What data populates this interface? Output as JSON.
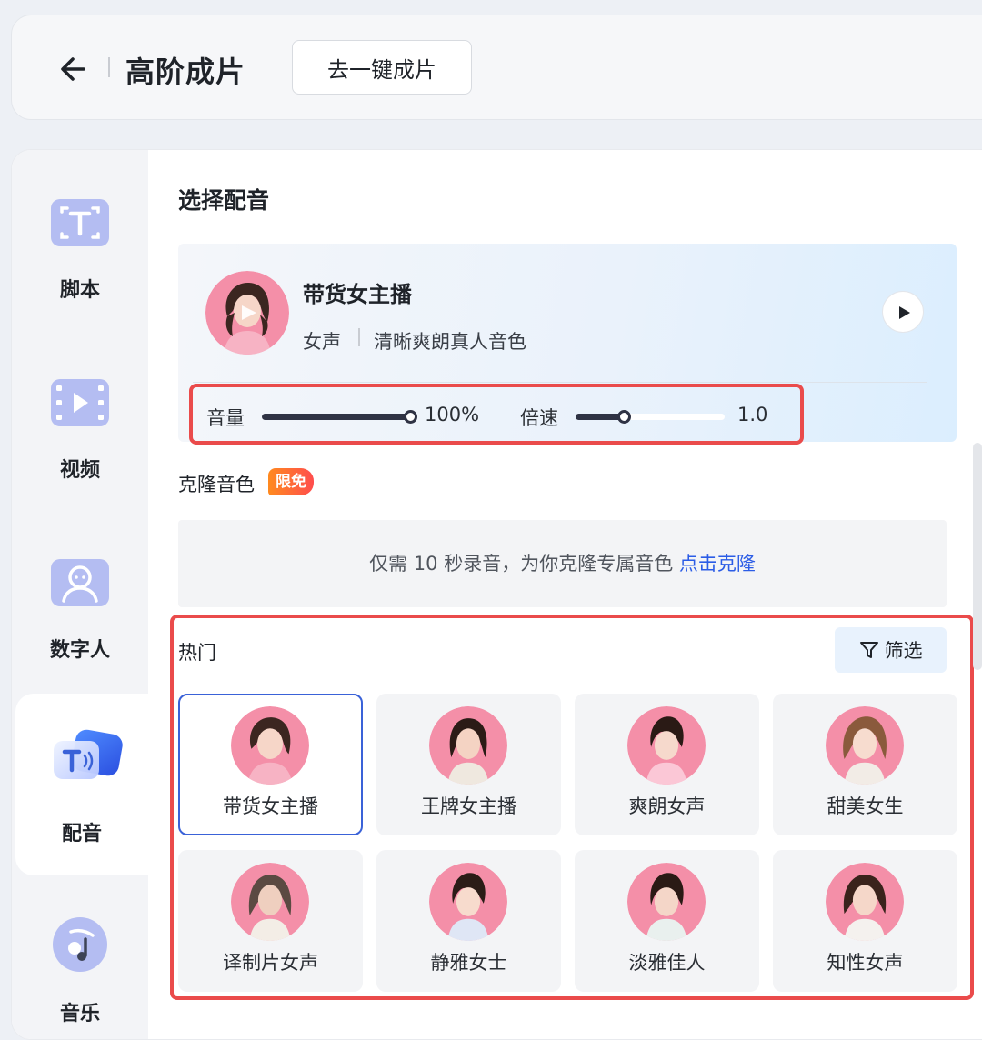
{
  "header": {
    "title": "高阶成片",
    "oneclick_label": "去一键成片"
  },
  "sidebar": {
    "items": [
      {
        "label": "脚本",
        "icon": "script-icon"
      },
      {
        "label": "视频",
        "icon": "video-icon"
      },
      {
        "label": "数字人",
        "icon": "avatar-icon"
      },
      {
        "label": "配音",
        "icon": "voiceover-icon",
        "active": true
      },
      {
        "label": "音乐",
        "icon": "music-icon"
      }
    ]
  },
  "main": {
    "section_title": "选择配音",
    "current_voice": {
      "name": "带货女主播",
      "gender": "女声",
      "description": "清晰爽朗真人音色"
    },
    "volume": {
      "label": "音量",
      "value": "100%",
      "fraction": 1.0
    },
    "speed": {
      "label": "倍速",
      "value": "1.0",
      "fraction": 0.33
    },
    "clone": {
      "title": "克隆音色",
      "badge": "限免",
      "prompt": "仅需 10 秒录音，为你克隆专属音色 ",
      "link": "点击克隆"
    },
    "hot": {
      "title": "热门",
      "filter_label": "筛选",
      "voices": [
        {
          "name": "带货女主播",
          "selected": true
        },
        {
          "name": "王牌女主播"
        },
        {
          "name": "爽朗女声"
        },
        {
          "name": "甜美女生"
        },
        {
          "name": "译制片女声"
        },
        {
          "name": "静雅女士"
        },
        {
          "name": "淡雅佳人"
        },
        {
          "name": "知性女声"
        }
      ]
    }
  },
  "colors": {
    "accent_blue": "#3a62d8",
    "highlight_red": "#ea4b4b",
    "avatar_bg": "#f48fa8"
  }
}
